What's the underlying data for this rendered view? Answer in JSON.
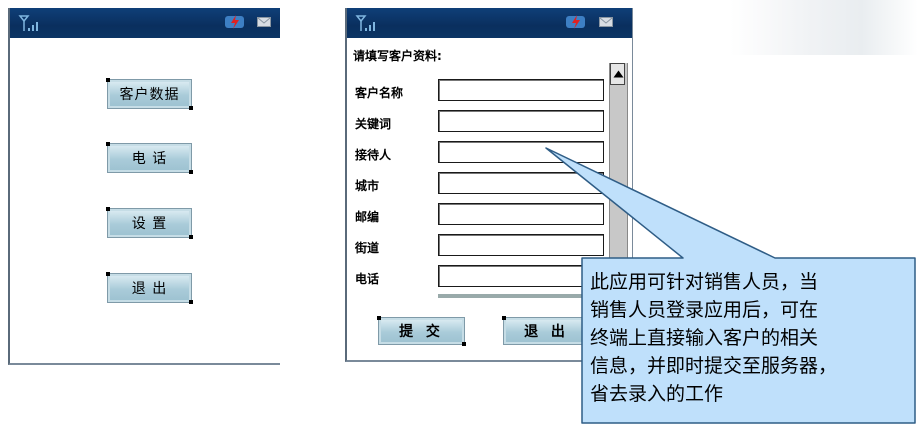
{
  "phone_left": {
    "menu": [
      {
        "label": "客户数据"
      },
      {
        "label": "电 话"
      },
      {
        "label": "设 置"
      },
      {
        "label": "退 出"
      }
    ]
  },
  "phone_right": {
    "form_title": "请填写客户资料:",
    "fields": [
      {
        "label": "客户名称",
        "value": ""
      },
      {
        "label": "关键词",
        "value": ""
      },
      {
        "label": "接待人",
        "value": ""
      },
      {
        "label": "城市",
        "value": ""
      },
      {
        "label": "邮编",
        "value": ""
      },
      {
        "label": "街道",
        "value": ""
      },
      {
        "label": "电话",
        "value": ""
      }
    ],
    "submit_label": "提 交",
    "exit_label": "退 出"
  },
  "callout": {
    "lines": [
      "此应用可针对销售人员，当",
      "销售人员登录应用后，可在",
      "终端上直接输入客户的相关",
      "信息，并即时提交至服务器，",
      "省去录入的工作"
    ]
  },
  "colors": {
    "statusbar": "#0b3565",
    "button": "#a9cbd9",
    "callout_fill": "#bfe0fb",
    "callout_stroke": "#2f5d86"
  },
  "icons": [
    "signal-strength-icon",
    "battery-icon",
    "message-icon"
  ]
}
